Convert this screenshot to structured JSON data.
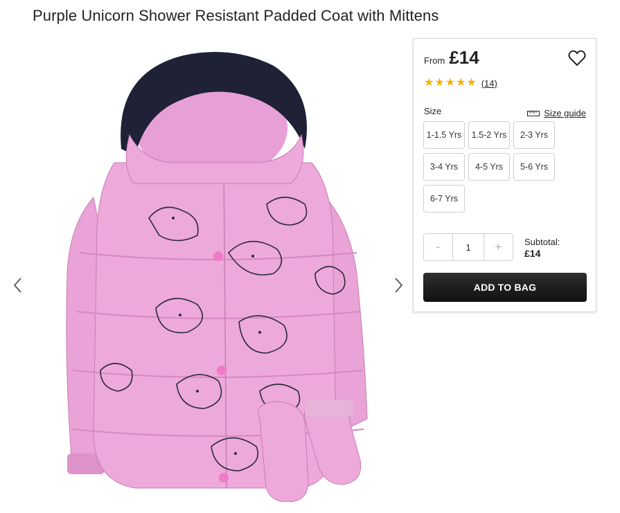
{
  "product": {
    "title": "Purple Unicorn Shower Resistant Padded Coat with Mittens",
    "image_alt": "Purple Unicorn Shower Resistant Padded Coat with Mittens"
  },
  "gallery": {
    "prev_icon": "chevron-left-icon",
    "next_icon": "chevron-right-icon"
  },
  "purchase": {
    "price_prefix": "From",
    "price": "£14",
    "wishlist_icon": "heart-icon",
    "rating": {
      "stars": 5,
      "max": 5,
      "review_count": "(14)"
    },
    "size_label": "Size",
    "size_guide_label": "Size guide",
    "size_guide_icon": "ruler-icon",
    "sizes": [
      "1-1.5 Yrs",
      "1.5-2 Yrs",
      "2-3 Yrs",
      "3-4 Yrs",
      "4-5 Yrs",
      "5-6 Yrs",
      "6-7 Yrs"
    ],
    "quantity": {
      "decrement": "-",
      "value": "1",
      "increment": "+"
    },
    "subtotal_label": "Subtotal:",
    "subtotal_value": "£14",
    "add_to_bag_label": "ADD TO BAG"
  },
  "colors": {
    "star": "#f2b400",
    "coat": "#e9a3d6",
    "fur": "#1f2236",
    "button": "#1a1a1a"
  }
}
